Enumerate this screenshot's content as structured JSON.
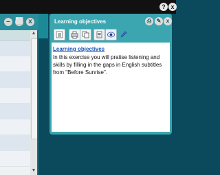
{
  "topbar": {
    "help_label": "?",
    "close_label": "x"
  },
  "left_window": {
    "controls": {
      "minimize": "–",
      "restore": "⬜",
      "close": "x"
    }
  },
  "learning_objectives_window": {
    "title": "Learning objectives",
    "controls": {
      "print": "⎙",
      "tools": "✎",
      "close": "x"
    },
    "toolbar_icons": [
      "document-icon",
      "print-icon",
      "copy-icon",
      "text-icon",
      "eye-icon",
      "pen-icon"
    ],
    "heading": "Learning objectives",
    "body_lines": [
      "In this exercise you will pratise listening and",
      "skills by filling in the gaps in English subtitles",
      "from \"Before Sunrise\"."
    ]
  },
  "colors": {
    "desktop": "#0a4a5c",
    "window_frame": "#3ba6b0",
    "link": "#1a57b8"
  }
}
